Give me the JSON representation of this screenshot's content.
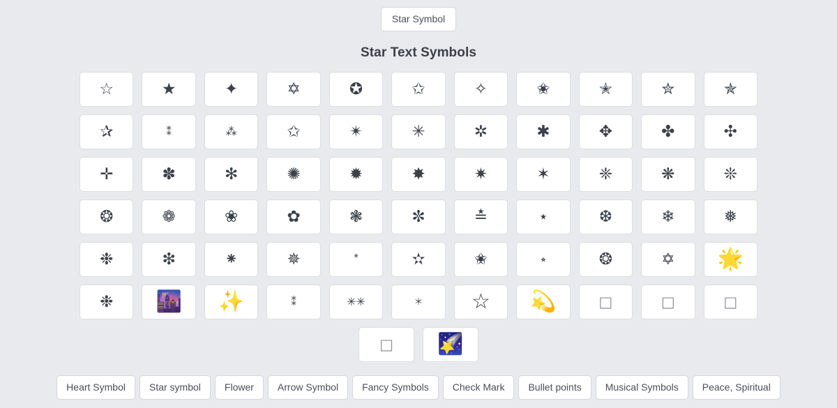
{
  "header": {
    "top_button_label": "Star Symbol",
    "page_title": "Star Text Symbols"
  },
  "colors": {
    "page_background": "#e9eaee",
    "card_background": "#ffffff",
    "card_border": "#dcdee3",
    "glyph_color": "#3c4149",
    "title_color": "#3b4048",
    "button_text": "#4a4f57"
  },
  "symbol_grid": {
    "columns": 11,
    "rows": [
      {
        "row_index": 1,
        "cells": [
          {
            "glyph": "☆",
            "name": "white-star",
            "size": "lg"
          },
          {
            "glyph": "★",
            "name": "black-star",
            "size": "lg"
          },
          {
            "glyph": "✦",
            "name": "black-four-pointed-star",
            "size": "lg"
          },
          {
            "glyph": "✡",
            "name": "star-of-david",
            "size": "lg"
          },
          {
            "glyph": "✪",
            "name": "circled-white-star",
            "size": "lg"
          },
          {
            "glyph": "✩",
            "name": "stress-outlined-white-star",
            "size": "lg"
          },
          {
            "glyph": "✧",
            "name": "white-four-pointed-star",
            "size": "lg"
          },
          {
            "glyph": "✬",
            "name": "black-centred-white-star",
            "size": "lg"
          },
          {
            "glyph": "✭",
            "name": "outlined-black-star",
            "size": "lg"
          },
          {
            "glyph": "✮",
            "name": "heavy-outlined-black-star",
            "size": "lg"
          },
          {
            "glyph": "✯",
            "name": "pinwheel-star",
            "size": "lg"
          }
        ]
      },
      {
        "row_index": 2,
        "cells": [
          {
            "glyph": "✰",
            "name": "shadowed-white-star",
            "size": "lg"
          },
          {
            "glyph": "⁑",
            "name": "two-asterisks-aligned-vertically",
            "size": "stack"
          },
          {
            "glyph": "⁂",
            "name": "asterism",
            "size": "sm"
          },
          {
            "glyph": "✩",
            "name": "stress-outlined-white-star-2",
            "size": "lg"
          },
          {
            "glyph": "✴",
            "name": "eight-pointed-black-star",
            "size": "lg"
          },
          {
            "glyph": "✳",
            "name": "eight-spoked-asterisk",
            "size": "lg"
          },
          {
            "glyph": "✲",
            "name": "open-centre-asterisk",
            "size": "lg"
          },
          {
            "glyph": "✱",
            "name": "heavy-asterisk",
            "size": "lg"
          },
          {
            "glyph": "✥",
            "name": "four-club-shaped-ballot",
            "size": "lg"
          },
          {
            "glyph": "✤",
            "name": "heavy-four-balloon-spoked-asterisk",
            "size": "lg"
          },
          {
            "glyph": "✣",
            "name": "four-balloon-spoked-asterisk",
            "size": "lg"
          }
        ]
      },
      {
        "row_index": 3,
        "cells": [
          {
            "glyph": "✛",
            "name": "open-centre-cross",
            "size": "lg"
          },
          {
            "glyph": "✽",
            "name": "heavy-teardrop-spoked-asterisk",
            "size": "lg"
          },
          {
            "glyph": "✻",
            "name": "teardrop-spoked-asterisk",
            "size": "lg"
          },
          {
            "glyph": "✺",
            "name": "sixteen-pointed-asterisk",
            "size": "lg"
          },
          {
            "glyph": "✹",
            "name": "twelve-pointed-black-star",
            "size": "lg"
          },
          {
            "glyph": "✸",
            "name": "eight-pointed-rectilinear-black-star",
            "size": "lg"
          },
          {
            "glyph": "✷",
            "name": "eight-pointed-pinwheel-star",
            "size": "lg"
          },
          {
            "glyph": "✶",
            "name": "six-pointed-black-star",
            "size": "lg"
          },
          {
            "glyph": "❈",
            "name": "heavy-sparkle",
            "size": "lg"
          },
          {
            "glyph": "❋",
            "name": "heavy-eight-teardrop-propeller-asterisk",
            "size": "lg"
          },
          {
            "glyph": "❊",
            "name": "eight-teardrop-propeller-asterisk",
            "size": "lg"
          }
        ]
      },
      {
        "row_index": 4,
        "cells": [
          {
            "glyph": "❂",
            "name": "circled-open-centre-eight-pointed-star",
            "size": "lg"
          },
          {
            "glyph": "❁",
            "name": "eight-petalled-florette",
            "size": "lg"
          },
          {
            "glyph": "❀",
            "name": "white-florette",
            "size": "lg"
          },
          {
            "glyph": "✿",
            "name": "black-florette",
            "size": "lg"
          },
          {
            "glyph": "❃",
            "name": "heavy-teardrop-spoked-pinwheel-asterisk",
            "size": "lg"
          },
          {
            "glyph": "✼",
            "name": "open-centre-teardrop-spoked-asterisk",
            "size": "lg"
          },
          {
            "glyph": "≛",
            "name": "star-equals",
            "size": "lg"
          },
          {
            "glyph": "⋆",
            "name": "star-operator",
            "size": "lg"
          },
          {
            "glyph": "❆",
            "name": "heavy-chevron-snowflake",
            "size": "lg"
          },
          {
            "glyph": "❄",
            "name": "snowflake",
            "size": "lg"
          },
          {
            "glyph": "❅",
            "name": "tight-trifoliate-snowflake",
            "size": "lg"
          }
        ]
      },
      {
        "row_index": 5,
        "cells": [
          {
            "glyph": "❉",
            "name": "balloon-spoked-asterisk",
            "size": "lg"
          },
          {
            "glyph": "❇",
            "name": "sparkle",
            "size": "lg"
          },
          {
            "glyph": "⁕",
            "name": "flower-punctuation-mark",
            "size": "lg"
          },
          {
            "glyph": "✵",
            "name": "eight-pointed-pinwheel-star-2",
            "size": "lg"
          },
          {
            "glyph": "⃰",
            "name": "combining-asterisk-above-star",
            "size": "sm"
          },
          {
            "glyph": "✫",
            "name": "open-centre-black-star",
            "size": "lg"
          },
          {
            "glyph": "✬",
            "name": "black-centred-white-star-2",
            "size": "lg"
          },
          {
            "glyph": "⭒",
            "name": "white-small-star",
            "size": "sm"
          },
          {
            "glyph": "❂",
            "name": "circled-open-centre-eight-pointed-star-2",
            "size": "lg"
          },
          {
            "glyph": "✡",
            "name": "star-of-david-2",
            "size": "lg"
          },
          {
            "glyph": "🌟",
            "name": "glowing-star",
            "size": "xl"
          }
        ]
      },
      {
        "row_index": 6,
        "cells": [
          {
            "glyph": "❉",
            "name": "balloon-spoked-asterisk-2",
            "size": "lg"
          },
          {
            "glyph": "🌆",
            "name": "cityscape-at-dusk",
            "size": "xl"
          },
          {
            "glyph": "✨",
            "name": "sparkles",
            "size": "xl"
          },
          {
            "glyph": "⁑",
            "name": "two-asterisks-aligned-vertically-2",
            "size": "stack"
          },
          {
            "glyph": "✳✳",
            "name": "double-eight-spoked-asterisk",
            "size": "sm"
          },
          {
            "glyph": "＊",
            "name": "fullwidth-asterisk",
            "size": "tiny"
          },
          {
            "glyph": "☆",
            "name": "white-star-2",
            "size": "xl"
          },
          {
            "glyph": "💫",
            "name": "dizzy-symbol",
            "size": "xl"
          },
          {
            "glyph": "□",
            "name": "missing-glyph-box-1",
            "size": "tofu"
          },
          {
            "glyph": "□",
            "name": "missing-glyph-box-2",
            "size": "tofu"
          },
          {
            "glyph": "□",
            "name": "missing-glyph-box-3",
            "size": "tofu"
          }
        ]
      },
      {
        "row_index": 7,
        "cells": [
          {
            "glyph": "□",
            "name": "missing-glyph-box-4",
            "size": "tofu"
          },
          {
            "glyph": "🌠",
            "name": "shooting-star",
            "size": "xl"
          }
        ]
      }
    ]
  },
  "bottom_nav": {
    "buttons": [
      {
        "label": "Heart Symbol",
        "name": "nav-heart-symbol"
      },
      {
        "label": "Star symbol",
        "name": "nav-star-symbol"
      },
      {
        "label": "Flower",
        "name": "nav-flower"
      },
      {
        "label": "Arrow Symbol",
        "name": "nav-arrow-symbol"
      },
      {
        "label": "Fancy Symbols",
        "name": "nav-fancy-symbols"
      },
      {
        "label": "Check Mark",
        "name": "nav-check-mark"
      },
      {
        "label": "Bullet points",
        "name": "nav-bullet-points"
      },
      {
        "label": "Musical Symbols",
        "name": "nav-musical-symbols"
      },
      {
        "label": "Peace, Spiritual",
        "name": "nav-peace-spiritual"
      }
    ]
  }
}
